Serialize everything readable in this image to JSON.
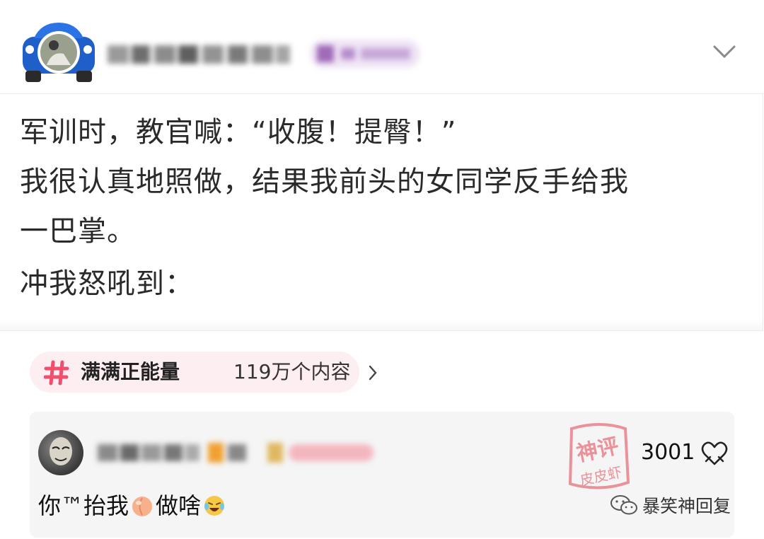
{
  "post": {
    "lines": [
      "军训时，教官喊：“收腹！提臀！”",
      "我很认真地照做，结果我前头的女同学反手给我",
      "一巴掌。",
      "冲我怒吼到："
    ]
  },
  "topic": {
    "name": "满满正能量",
    "count": "119万个内容",
    "icon": "hash-icon",
    "accent": "#f0506e"
  },
  "comment": {
    "likes": "3001",
    "text_before": "你™抬我",
    "text_after": "做啥",
    "emoji_1": "peach-emoji",
    "emoji_2": "crying-laughing-emoji",
    "stamp_text_top": "神评",
    "stamp_text_bottom": "皮皮虾",
    "stamp_color": "#e2404f"
  },
  "watermark": {
    "icon": "wechat-icon",
    "label": "暴笑神回复"
  }
}
